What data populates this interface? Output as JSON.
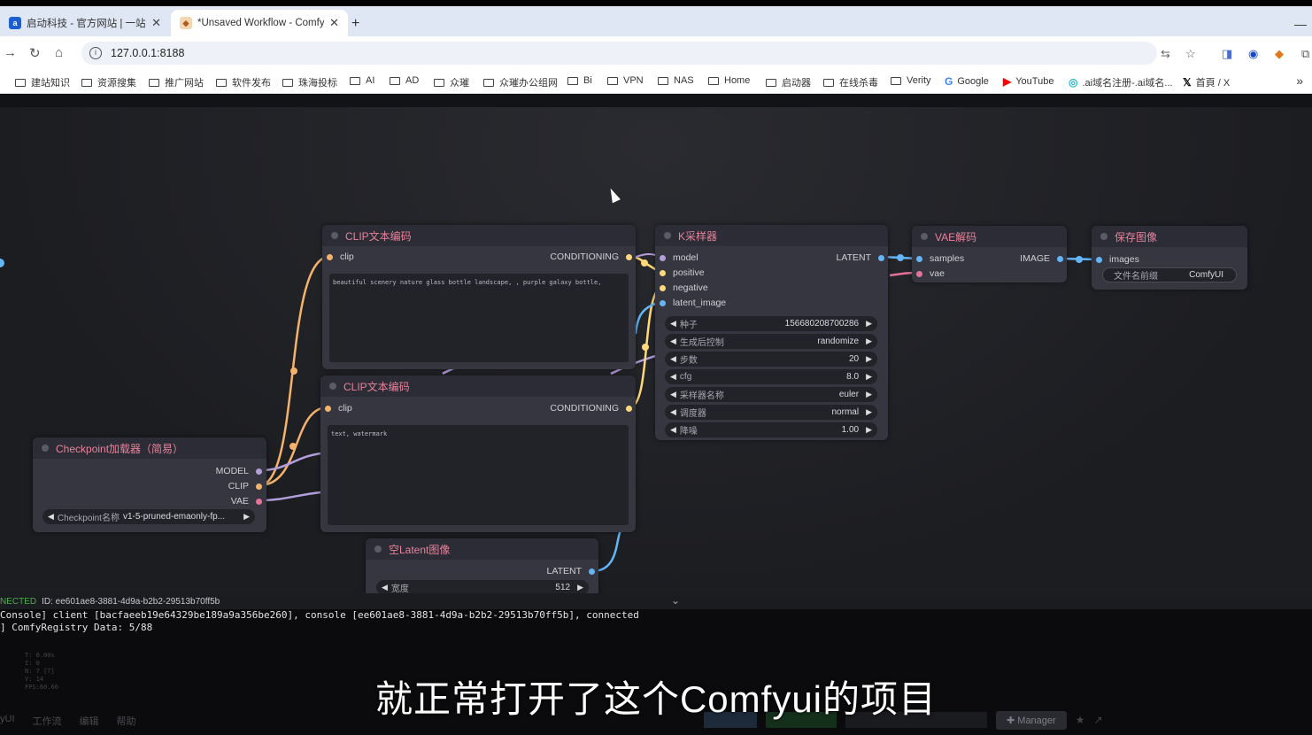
{
  "browser": {
    "tabs": [
      {
        "title": "启动科技 - 官方网站 | 一站式AI",
        "favicon": "ai-icon",
        "active": false
      },
      {
        "title": "*Unsaved Workflow - ComfyUI",
        "favicon": "comfy-icon",
        "active": true
      }
    ],
    "url": "127.0.0.1:8188",
    "bookmarks": [
      "建站知识",
      "资源搜集",
      "推广网站",
      "软件发布",
      "珠海投标",
      "AI",
      "AD",
      "众璀",
      "众璀办公组网",
      "Bi",
      "VPN",
      "NAS",
      "Home",
      "启动器",
      "在线杀毒",
      "Verity",
      "Google",
      "YouTube",
      ".ai域名注册-.ai域名...",
      "首頁 / X"
    ]
  },
  "nodes": {
    "clip1": {
      "title": "CLIP文本编码",
      "input": "clip",
      "output": "CONDITIONING",
      "text": "beautiful scenery nature glass bottle landscape, , purple galaxy bottle,"
    },
    "clip2": {
      "title": "CLIP文本编码",
      "input": "clip",
      "output": "CONDITIONING",
      "text": "text, watermark"
    },
    "checkpoint": {
      "title": "Checkpoint加载器（简易）",
      "outputs": [
        "MODEL",
        "CLIP",
        "VAE"
      ],
      "widget_label": "Checkpoint名称",
      "widget_value": "v1-5-pruned-emaonly-fp..."
    },
    "latent": {
      "title": "空Latent图像",
      "output": "LATENT",
      "widget_label": "宽度",
      "widget_value": "512"
    },
    "ksampler": {
      "title": "K采样器",
      "inputs": [
        "model",
        "positive",
        "negative",
        "latent_image"
      ],
      "output": "LATENT",
      "widgets": [
        {
          "label": "种子",
          "value": "156680208700286"
        },
        {
          "label": "生成后控制",
          "value": "randomize"
        },
        {
          "label": "步数",
          "value": "20"
        },
        {
          "label": "cfg",
          "value": "8.0"
        },
        {
          "label": "采样器名称",
          "value": "euler"
        },
        {
          "label": "调度器",
          "value": "normal"
        },
        {
          "label": "降噪",
          "value": "1.00"
        }
      ]
    },
    "vae": {
      "title": "VAE解码",
      "inputs": [
        "samples",
        "vae"
      ],
      "output": "IMAGE"
    },
    "save": {
      "title": "保存图像",
      "input": "images",
      "widget_label": "文件名前缀",
      "widget_value": "ComfyUI"
    }
  },
  "console": {
    "status_prefix": "NECTED",
    "status_id": "ID: ee601ae8-3881-4d9a-b2b2-29513b70ff5b",
    "lines": [
      "Console] client [bacfaeeb19e64329be189a9a356be260], console [ee601ae8-3881-4d9a-b2b2-29513b70ff5b], connected",
      "] ComfyRegistry Data: 5/88"
    ],
    "menu": [
      "yUI",
      "工作流",
      "编辑",
      "帮助"
    ],
    "manager_label": "Manager",
    "subtitle": "就正常打开了这个Comfyui的项目"
  },
  "colors": {
    "clip_link": "#f5b26b",
    "model_link": "#b39ddb",
    "vae_link": "#e57399",
    "latent_link": "#64b5f6",
    "conditioning_link": "#ffd97a",
    "node_title": "#e8829a"
  }
}
